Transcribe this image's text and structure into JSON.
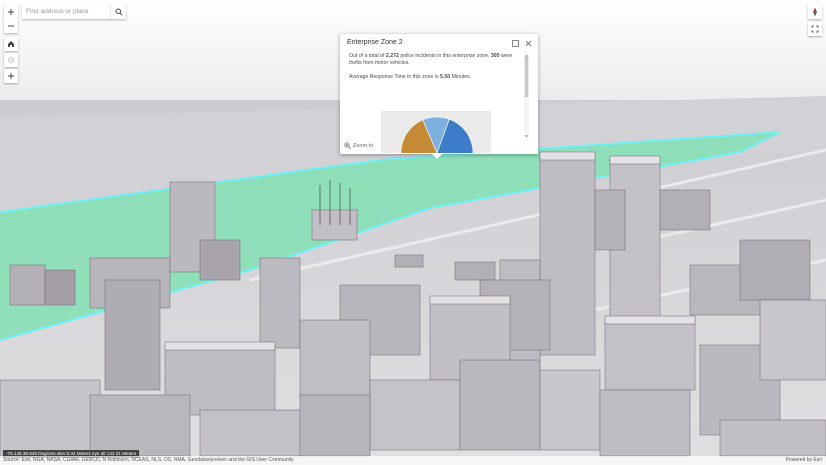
{
  "search": {
    "placeholder": "Find address or place"
  },
  "nav": {
    "compass_label": "N"
  },
  "popup": {
    "title": "Enterprise Zone 2",
    "p1_a": "Out of a total of ",
    "p1_total": "2,272",
    "p1_b": " police incidents in this enterprise zone, ",
    "p1_count": "305",
    "p1_c": " were thefts from motor vehicles.",
    "p2_a": "Average Response Time in this zone is ",
    "p2_time": "5.50",
    "p2_b": " Minutes.",
    "zoom_label": "Zoom to"
  },
  "chart_data": {
    "type": "pie",
    "title": "",
    "slices": [
      {
        "value": 0.66,
        "color": "#3d7cc9"
      },
      {
        "value": 0.22,
        "color": "#c58a35"
      },
      {
        "value": 0.12,
        "color": "#7fb1e0"
      }
    ]
  },
  "footer": {
    "coords": "-75.146 39.948 Degrees   elev 5.04 Meters   eye alt 142.31 Meters",
    "attribution": "Source: Esri, NGA, NASA, CGIAR, GEBCO, N Robinson, NCEAS, NLS, OS, NMA, Geodatastyrelsen and the GIS User Community",
    "powered_by": "Powered by Esri"
  },
  "colors": {
    "zone_fill": "#7fe0b2",
    "zone_outline": "#6ff0f4",
    "building": "#a8a3ab",
    "ground": "#d9d8dc"
  }
}
